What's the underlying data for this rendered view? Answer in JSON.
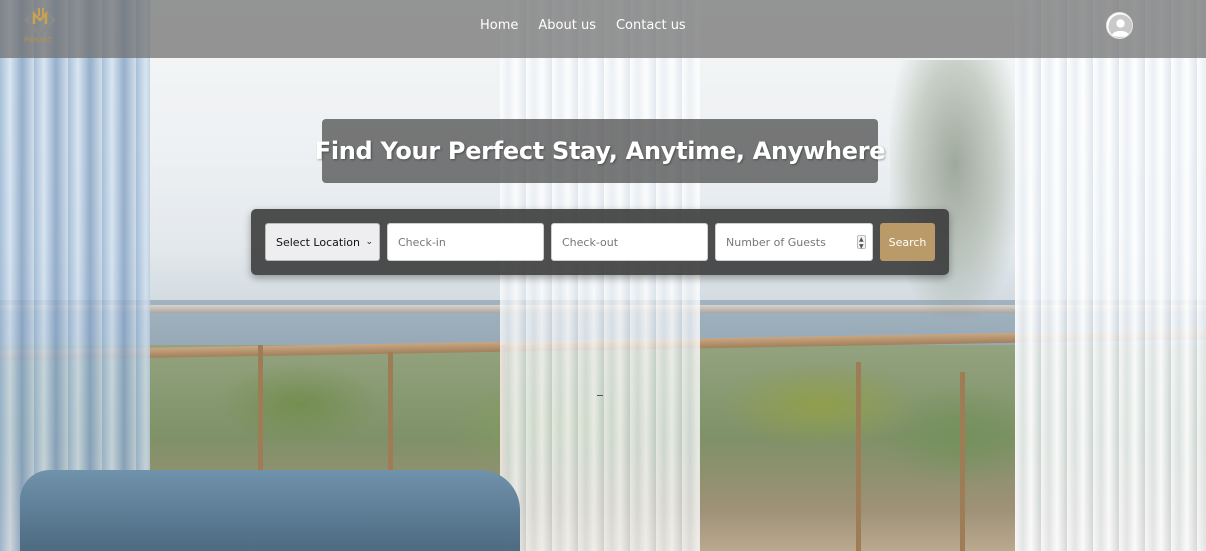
{
  "brand": {
    "logo_text": "PoHanT",
    "accent_color": "#b8923f"
  },
  "nav": {
    "links": [
      "Home",
      "About us",
      "Contact us"
    ],
    "avatar_icon": "user-avatar-icon"
  },
  "hero": {
    "title": "Find Your Perfect Stay, Anytime, Anywhere"
  },
  "search": {
    "location_selected": "Select Location",
    "checkin_placeholder": "Check-in",
    "checkout_placeholder": "Check-out",
    "guests_placeholder": "Number of Guests",
    "search_label": "Search",
    "button_color": "#b99a68"
  }
}
